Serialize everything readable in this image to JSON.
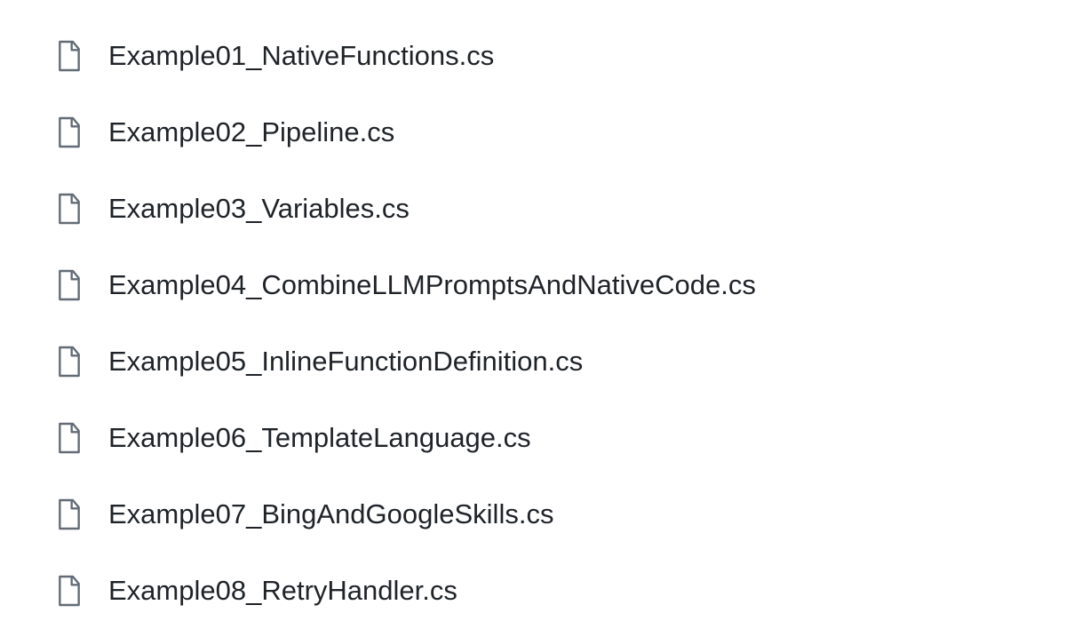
{
  "files": [
    {
      "name": "Example01_NativeFunctions.cs"
    },
    {
      "name": "Example02_Pipeline.cs"
    },
    {
      "name": "Example03_Variables.cs"
    },
    {
      "name": "Example04_CombineLLMPromptsAndNativeCode.cs"
    },
    {
      "name": "Example05_InlineFunctionDefinition.cs"
    },
    {
      "name": "Example06_TemplateLanguage.cs"
    },
    {
      "name": "Example07_BingAndGoogleSkills.cs"
    },
    {
      "name": "Example08_RetryHandler.cs"
    }
  ]
}
